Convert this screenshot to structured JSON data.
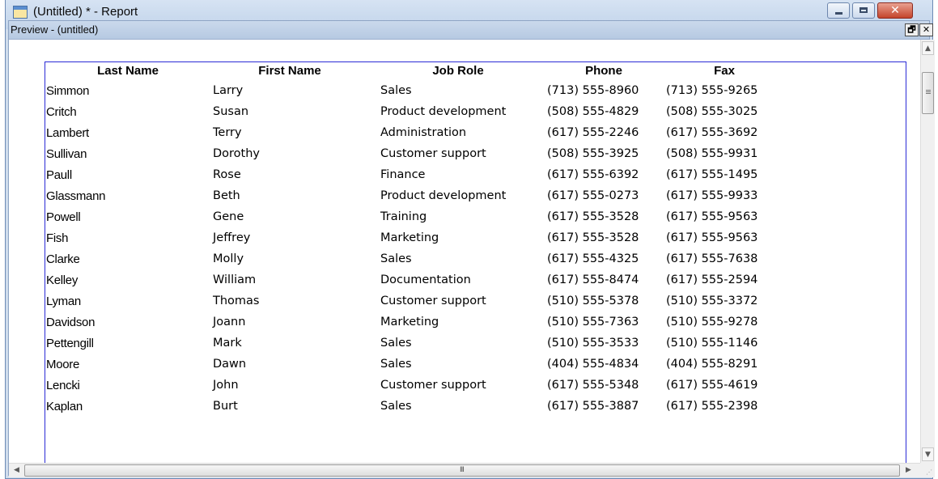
{
  "window": {
    "title": "(Untitled) * - Report",
    "minimize_glyph": "",
    "maximize_glyph": "",
    "close_glyph": "✕"
  },
  "child_window": {
    "title": "Preview - (untitled)",
    "restore_glyph": "🗗",
    "close_glyph": "✕"
  },
  "report": {
    "columns": [
      "Last Name",
      "First Name",
      "Job Role",
      "Phone",
      "Fax"
    ],
    "rows": [
      {
        "last": "Simmon",
        "first": "Larry",
        "role": "Sales",
        "phone": "(713) 555-8960",
        "fax": "(713) 555-9265"
      },
      {
        "last": "Critch",
        "first": "Susan",
        "role": "Product development",
        "phone": "(508) 555-4829",
        "fax": "(508) 555-3025"
      },
      {
        "last": "Lambert",
        "first": "Terry",
        "role": "Administration",
        "phone": "(617) 555-2246",
        "fax": "(617) 555-3692"
      },
      {
        "last": "Sullivan",
        "first": "Dorothy",
        "role": "Customer support",
        "phone": "(508) 555-3925",
        "fax": "(508) 555-9931"
      },
      {
        "last": "Paull",
        "first": "Rose",
        "role": "Finance",
        "phone": "(617) 555-6392",
        "fax": "(617) 555-1495"
      },
      {
        "last": "Glassmann",
        "first": "Beth",
        "role": "Product development",
        "phone": "(617) 555-0273",
        "fax": "(617) 555-9933"
      },
      {
        "last": "Powell",
        "first": "Gene",
        "role": "Training",
        "phone": "(617) 555-3528",
        "fax": "(617) 555-9563"
      },
      {
        "last": "Fish",
        "first": "Jeffrey",
        "role": "Marketing",
        "phone": "(617) 555-3528",
        "fax": "(617) 555-9563"
      },
      {
        "last": "Clarke",
        "first": "Molly",
        "role": "Sales",
        "phone": "(617) 555-4325",
        "fax": "(617) 555-7638"
      },
      {
        "last": "Kelley",
        "first": "William",
        "role": "Documentation",
        "phone": "(617) 555-8474",
        "fax": "(617) 555-2594"
      },
      {
        "last": "Lyman",
        "first": "Thomas",
        "role": "Customer support",
        "phone": "(510) 555-5378",
        "fax": "(510) 555-3372"
      },
      {
        "last": "Davidson",
        "first": "Joann",
        "role": "Marketing",
        "phone": "(510) 555-7363",
        "fax": "(510) 555-9278"
      },
      {
        "last": "Pettengill",
        "first": "Mark",
        "role": "Sales",
        "phone": "(510) 555-3533",
        "fax": "(510) 555-1146"
      },
      {
        "last": "Moore",
        "first": "Dawn",
        "role": "Sales",
        "phone": "(404) 555-4834",
        "fax": "(404) 555-8291"
      },
      {
        "last": "Lencki",
        "first": "John",
        "role": "Customer support",
        "phone": "(617) 555-5348",
        "fax": "(617) 555-4619"
      },
      {
        "last": "Kaplan",
        "first": "Burt",
        "role": "Sales",
        "phone": "(617) 555-3887",
        "fax": "(617) 555-2398"
      }
    ]
  },
  "scrollbars": {
    "up_glyph": "▲",
    "down_glyph": "▼",
    "left_glyph": "◀",
    "right_glyph": "▶",
    "grip_glyph": "III",
    "vertical_position_fraction": 0.0,
    "horizontal_position_fraction": 0.0
  },
  "colors": {
    "report_border": "#2b2bd6",
    "titlebar": "#cad9ec",
    "close_button": "#c4442b"
  }
}
